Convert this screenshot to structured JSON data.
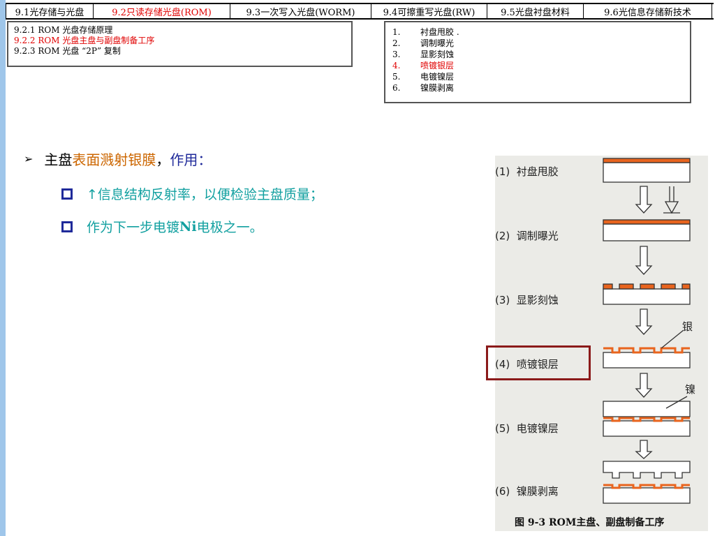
{
  "tabs": [
    {
      "label": "9.1光存储与光盘",
      "width": 126
    },
    {
      "label": "9.2只读存储光盘(ROM)",
      "width": 196,
      "active": true
    },
    {
      "label": "9.3一次写入光盘(WORM)",
      "width": 202
    },
    {
      "label": "9.4可擦重写光盘(RW)",
      "width": 166
    },
    {
      "label": "9.5光盘衬盘材料",
      "width": 138
    },
    {
      "label": "9.6光信息存储新技术",
      "width": 184
    }
  ],
  "submenu": {
    "items": [
      "9.2.1 ROM 光盘存储原理",
      "9.2.2 ROM 光盘主盘与副盘制备工序",
      "9.2.3 ROM 光盘 “2P” 复制"
    ]
  },
  "steps_box": {
    "items": [
      {
        "num": "1.",
        "text": "衬盘甩胶      ."
      },
      {
        "num": "2.",
        "text": "调制曝光"
      },
      {
        "num": "3.",
        "text": "显影刻蚀"
      },
      {
        "num": "4.",
        "text": "喷镀银层"
      },
      {
        "num": "5.",
        "text": "电镀镍层"
      },
      {
        "num": "6.",
        "text": "镍膜剥离"
      }
    ]
  },
  "content": {
    "main_prefix": "主盘",
    "main_highlight": "表面溅射银膜",
    "main_comma": "，",
    "main_effect": "作用：",
    "sub1": "↑信息结构反射率，以便检验主盘质量；",
    "sub2_a": "作为下一步电镀",
    "sub2_b": "Ni",
    "sub2_c": "电极之一。"
  },
  "figure": {
    "steps": [
      {
        "num": "(1)",
        "name": "衬盘甩胶"
      },
      {
        "num": "(2)",
        "name": "调制曝光"
      },
      {
        "num": "(3)",
        "name": "显影刻蚀"
      },
      {
        "num": "(4)",
        "name": "喷镀银层"
      },
      {
        "num": "(5)",
        "name": "电镀镍层"
      },
      {
        "num": "(6)",
        "name": "镍膜剥离"
      }
    ],
    "label_silver": "银",
    "label_nickel": "镍",
    "caption": "图 9-3 ROM主盘、副盘制备工序"
  },
  "colors": {
    "active_red": "#e00000",
    "highlight_orange": "#cc6600",
    "effect_blue": "#1f2a9a",
    "sub_teal": "#12a0a0",
    "silver_layer": "#e8641e",
    "box_border": "#8b1a1a",
    "left_strip": "#9fc6ea"
  },
  "icons": {
    "main_bullet": "arrow-bullet-icon",
    "sub_bullet": "hollow-square-bullet-icon"
  }
}
